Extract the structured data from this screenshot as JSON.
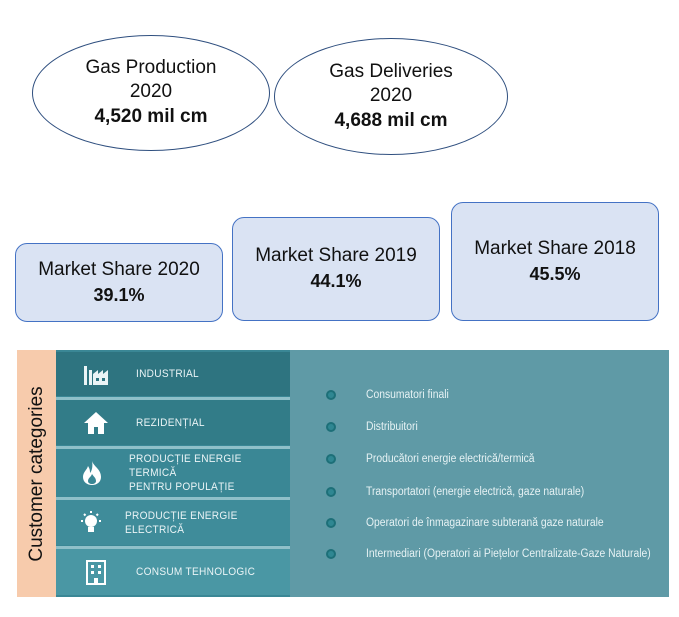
{
  "ellipses": [
    {
      "title_line1": "Gas Production",
      "title_line2": "2020",
      "value": "4,520 mil cm"
    },
    {
      "title_line1": "Gas Deliveries",
      "title_line2": "2020",
      "value": "4,688 mil cm"
    }
  ],
  "market_share": [
    {
      "label": "Market Share 2020",
      "value": "39.1%"
    },
    {
      "label": "Market Share 2019",
      "value": "44.1%"
    },
    {
      "label": "Market Share 2018",
      "value": "45.5%"
    }
  ],
  "customer_label": "Customer categories",
  "categories": [
    {
      "line1": "INDUSTRIAL",
      "line2": "",
      "icon": "factory-icon"
    },
    {
      "line1": "REZIDENȚIAL",
      "line2": "",
      "icon": "house-icon"
    },
    {
      "line1": "PRODUCȚIE ENERGIE TERMICĂ",
      "line2": "PENTRU POPULAȚIE",
      "icon": "flame-icon"
    },
    {
      "line1": "PRODUCȚIE ENERGIE ELECTRICĂ",
      "line2": "",
      "icon": "lightbulb-icon"
    },
    {
      "line1": "CONSUM TEHNOLOGIC",
      "line2": "",
      "icon": "building-icon"
    }
  ],
  "clients": [
    "Consumatori finali",
    "Distribuitori",
    "Producători energie electrică/termică",
    "Transportatori (energie electrică, gaze naturale)",
    "Operatori de înmagazinare subterană gaze naturale",
    "Intermediari (Operatori ai Piețelor Centralizate-Gaze Naturale)"
  ],
  "colors": {
    "accent_blue": "#4472c4",
    "box_fill": "#dae3f3",
    "label_fill": "#f7cbac",
    "teal_dark": "#2e7480",
    "teal_panel": "#5f9aa6"
  }
}
